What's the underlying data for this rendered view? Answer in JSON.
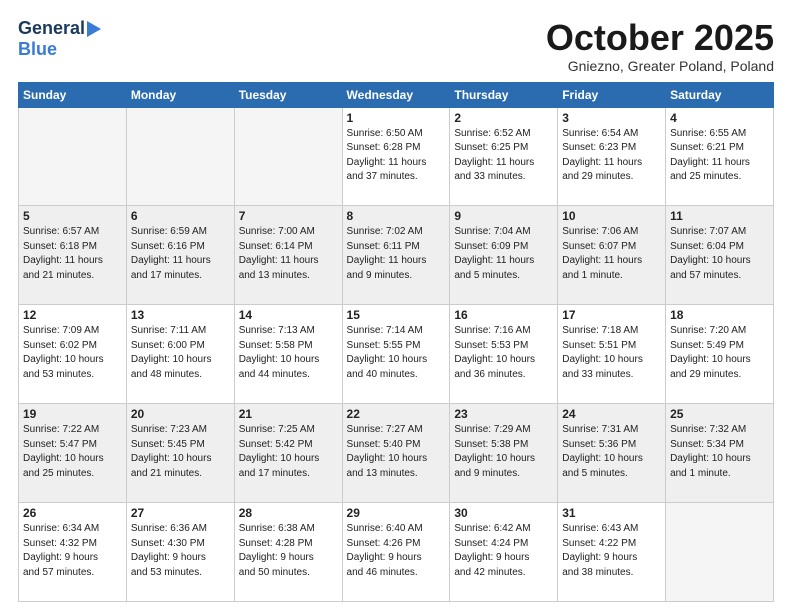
{
  "logo": {
    "line1": "General",
    "line2": "Blue"
  },
  "title": "October 2025",
  "location": "Gniezno, Greater Poland, Poland",
  "days_header": [
    "Sunday",
    "Monday",
    "Tuesday",
    "Wednesday",
    "Thursday",
    "Friday",
    "Saturday"
  ],
  "weeks": [
    [
      {
        "day": "",
        "info": ""
      },
      {
        "day": "",
        "info": ""
      },
      {
        "day": "",
        "info": ""
      },
      {
        "day": "1",
        "info": "Sunrise: 6:50 AM\nSunset: 6:28 PM\nDaylight: 11 hours\nand 37 minutes."
      },
      {
        "day": "2",
        "info": "Sunrise: 6:52 AM\nSunset: 6:25 PM\nDaylight: 11 hours\nand 33 minutes."
      },
      {
        "day": "3",
        "info": "Sunrise: 6:54 AM\nSunset: 6:23 PM\nDaylight: 11 hours\nand 29 minutes."
      },
      {
        "day": "4",
        "info": "Sunrise: 6:55 AM\nSunset: 6:21 PM\nDaylight: 11 hours\nand 25 minutes."
      }
    ],
    [
      {
        "day": "5",
        "info": "Sunrise: 6:57 AM\nSunset: 6:18 PM\nDaylight: 11 hours\nand 21 minutes."
      },
      {
        "day": "6",
        "info": "Sunrise: 6:59 AM\nSunset: 6:16 PM\nDaylight: 11 hours\nand 17 minutes."
      },
      {
        "day": "7",
        "info": "Sunrise: 7:00 AM\nSunset: 6:14 PM\nDaylight: 11 hours\nand 13 minutes."
      },
      {
        "day": "8",
        "info": "Sunrise: 7:02 AM\nSunset: 6:11 PM\nDaylight: 11 hours\nand 9 minutes."
      },
      {
        "day": "9",
        "info": "Sunrise: 7:04 AM\nSunset: 6:09 PM\nDaylight: 11 hours\nand 5 minutes."
      },
      {
        "day": "10",
        "info": "Sunrise: 7:06 AM\nSunset: 6:07 PM\nDaylight: 11 hours\nand 1 minute."
      },
      {
        "day": "11",
        "info": "Sunrise: 7:07 AM\nSunset: 6:04 PM\nDaylight: 10 hours\nand 57 minutes."
      }
    ],
    [
      {
        "day": "12",
        "info": "Sunrise: 7:09 AM\nSunset: 6:02 PM\nDaylight: 10 hours\nand 53 minutes."
      },
      {
        "day": "13",
        "info": "Sunrise: 7:11 AM\nSunset: 6:00 PM\nDaylight: 10 hours\nand 48 minutes."
      },
      {
        "day": "14",
        "info": "Sunrise: 7:13 AM\nSunset: 5:58 PM\nDaylight: 10 hours\nand 44 minutes."
      },
      {
        "day": "15",
        "info": "Sunrise: 7:14 AM\nSunset: 5:55 PM\nDaylight: 10 hours\nand 40 minutes."
      },
      {
        "day": "16",
        "info": "Sunrise: 7:16 AM\nSunset: 5:53 PM\nDaylight: 10 hours\nand 36 minutes."
      },
      {
        "day": "17",
        "info": "Sunrise: 7:18 AM\nSunset: 5:51 PM\nDaylight: 10 hours\nand 33 minutes."
      },
      {
        "day": "18",
        "info": "Sunrise: 7:20 AM\nSunset: 5:49 PM\nDaylight: 10 hours\nand 29 minutes."
      }
    ],
    [
      {
        "day": "19",
        "info": "Sunrise: 7:22 AM\nSunset: 5:47 PM\nDaylight: 10 hours\nand 25 minutes."
      },
      {
        "day": "20",
        "info": "Sunrise: 7:23 AM\nSunset: 5:45 PM\nDaylight: 10 hours\nand 21 minutes."
      },
      {
        "day": "21",
        "info": "Sunrise: 7:25 AM\nSunset: 5:42 PM\nDaylight: 10 hours\nand 17 minutes."
      },
      {
        "day": "22",
        "info": "Sunrise: 7:27 AM\nSunset: 5:40 PM\nDaylight: 10 hours\nand 13 minutes."
      },
      {
        "day": "23",
        "info": "Sunrise: 7:29 AM\nSunset: 5:38 PM\nDaylight: 10 hours\nand 9 minutes."
      },
      {
        "day": "24",
        "info": "Sunrise: 7:31 AM\nSunset: 5:36 PM\nDaylight: 10 hours\nand 5 minutes."
      },
      {
        "day": "25",
        "info": "Sunrise: 7:32 AM\nSunset: 5:34 PM\nDaylight: 10 hours\nand 1 minute."
      }
    ],
    [
      {
        "day": "26",
        "info": "Sunrise: 6:34 AM\nSunset: 4:32 PM\nDaylight: 9 hours\nand 57 minutes."
      },
      {
        "day": "27",
        "info": "Sunrise: 6:36 AM\nSunset: 4:30 PM\nDaylight: 9 hours\nand 53 minutes."
      },
      {
        "day": "28",
        "info": "Sunrise: 6:38 AM\nSunset: 4:28 PM\nDaylight: 9 hours\nand 50 minutes."
      },
      {
        "day": "29",
        "info": "Sunrise: 6:40 AM\nSunset: 4:26 PM\nDaylight: 9 hours\nand 46 minutes."
      },
      {
        "day": "30",
        "info": "Sunrise: 6:42 AM\nSunset: 4:24 PM\nDaylight: 9 hours\nand 42 minutes."
      },
      {
        "day": "31",
        "info": "Sunrise: 6:43 AM\nSunset: 4:22 PM\nDaylight: 9 hours\nand 38 minutes."
      },
      {
        "day": "",
        "info": ""
      }
    ]
  ]
}
